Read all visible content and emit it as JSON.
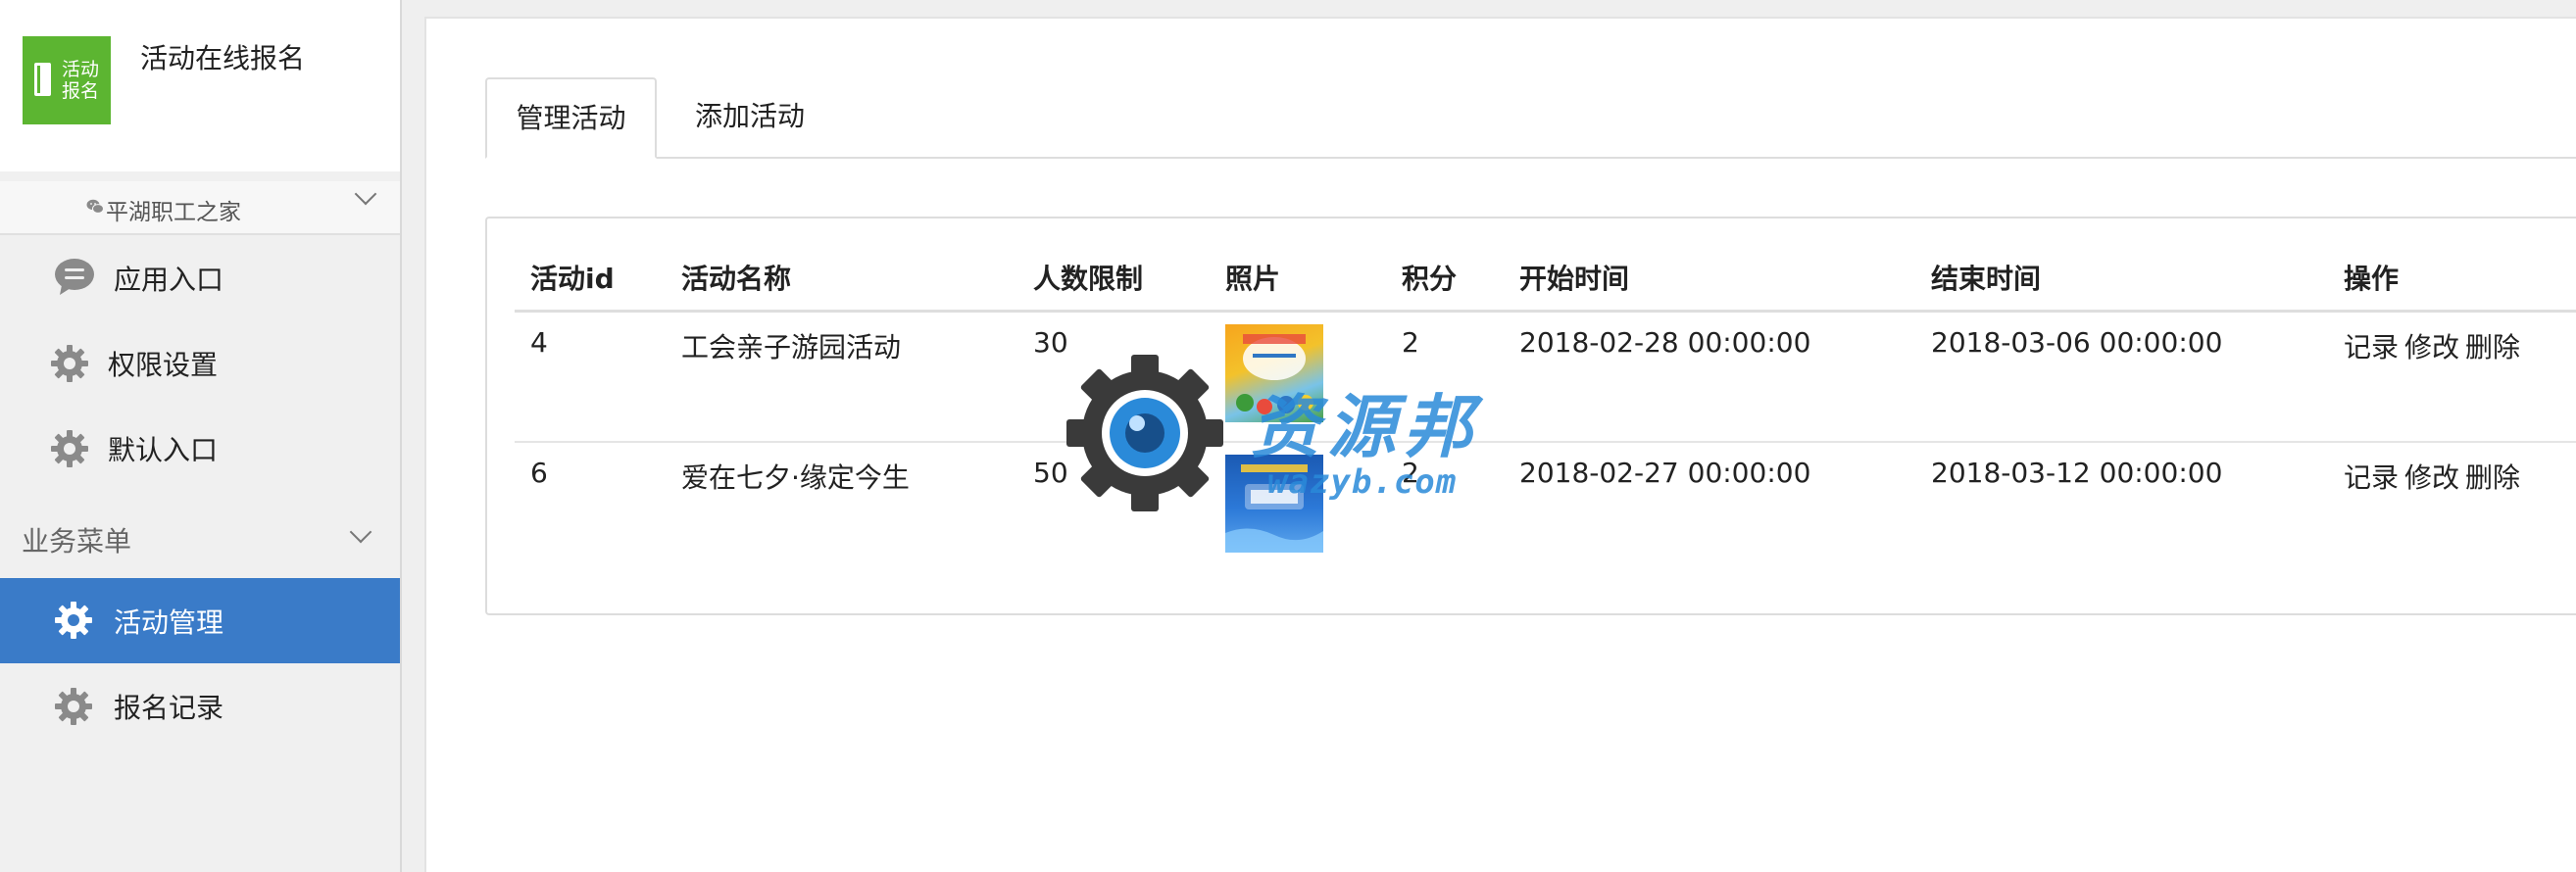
{
  "app": {
    "logo_text": "活动报名",
    "title": "活动在线报名"
  },
  "account": {
    "icon": "wechat-icon",
    "name": "平湖职工之家"
  },
  "sidebar": {
    "items": [
      {
        "label": "应用入口",
        "icon": "chat-icon"
      },
      {
        "label": "权限设置",
        "icon": "gear-icon"
      },
      {
        "label": "默认入口",
        "icon": "gear-icon"
      }
    ],
    "section": {
      "label": "业务菜单",
      "items": [
        {
          "label": "活动管理",
          "icon": "gear-icon",
          "active": true
        },
        {
          "label": "报名记录",
          "icon": "gear-icon",
          "active": false
        }
      ]
    }
  },
  "tabs": [
    {
      "label": "管理活动",
      "active": true
    },
    {
      "label": "添加活动",
      "active": false
    }
  ],
  "table": {
    "headers": [
      "活动id",
      "活动名称",
      "人数限制",
      "照片",
      "积分",
      "开始时间",
      "结束时间",
      "操作"
    ],
    "rows": [
      {
        "id": "4",
        "name": "工会亲子游园活动",
        "limit": "30",
        "photo": "thumb-1",
        "points": "2",
        "start": "2018-02-28 00:00:00",
        "end": "2018-03-06 00:00:00"
      },
      {
        "id": "6",
        "name": "爱在七夕·缘定今生",
        "limit": "50",
        "photo": "thumb-2",
        "points": "2",
        "start": "2018-02-27 00:00:00",
        "end": "2018-03-12 00:00:00"
      }
    ],
    "actions": [
      "记录",
      "修改",
      "删除"
    ]
  },
  "watermark": {
    "text_cn": "资源邦",
    "text_url": "wazyb.com"
  },
  "colors": {
    "brand_green": "#5cb531",
    "active_blue": "#3a7bc8",
    "icon_gray": "#8a8a8a",
    "watermark_blue": "#2a8ad9"
  }
}
